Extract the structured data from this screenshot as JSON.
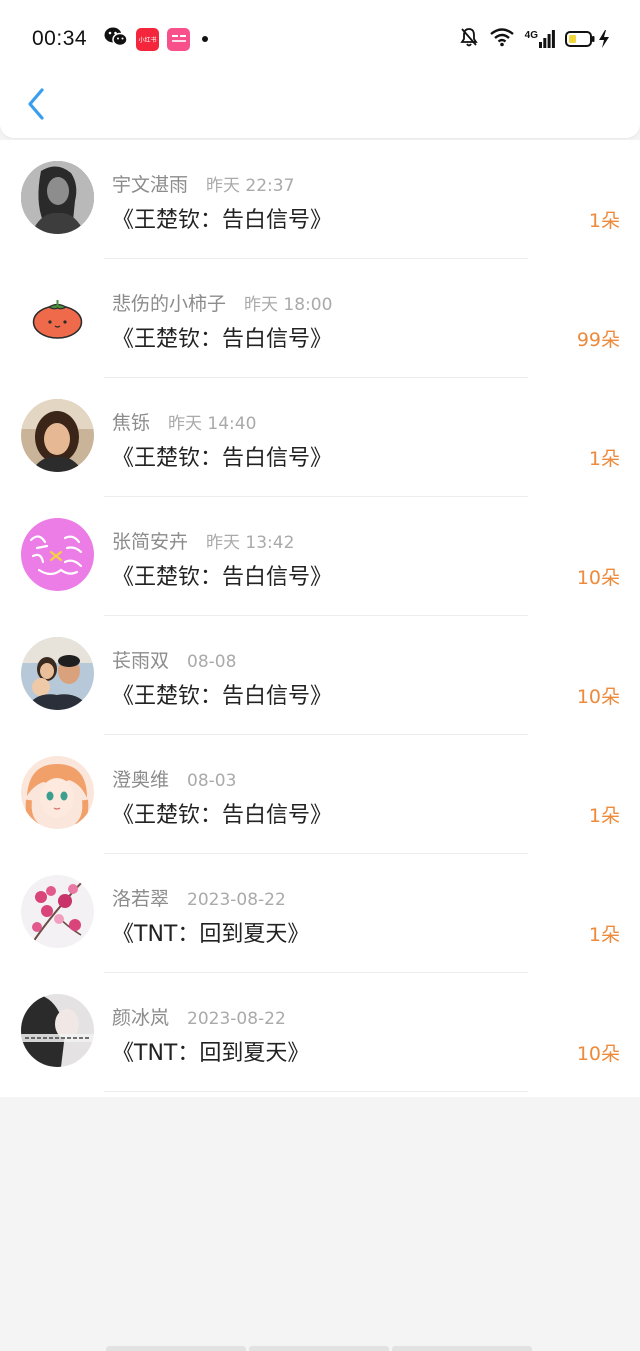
{
  "status_bar": {
    "time": "00:34",
    "apps": [
      {
        "icon": "wechat-icon"
      },
      {
        "icon": "xiaohongshu-icon",
        "label": "小红书",
        "color": "#f3263c"
      },
      {
        "icon": "app-icon",
        "label": "",
        "color": "#f7508b"
      }
    ],
    "right_icons": [
      "notification-muted-icon",
      "wifi-icon",
      "4g-signal-icon",
      "battery-charging-icon"
    ],
    "network": "4G"
  },
  "header": {
    "back_icon": "back-chevron-icon",
    "back_color": "#3a9ef0"
  },
  "rows": [
    {
      "name": "宇文湛雨",
      "time": "昨天 22:37",
      "song": "《王楚钦：告白信号》",
      "count": "1朵"
    },
    {
      "name": "悲伤的小柿子",
      "time": "昨天 18:00",
      "song": "《王楚钦：告白信号》",
      "count": "99朵"
    },
    {
      "name": "焦铄",
      "time": "昨天 14:40",
      "song": "《王楚钦：告白信号》",
      "count": "1朵"
    },
    {
      "name": "张简安卉",
      "time": "昨天 13:42",
      "song": "《王楚钦：告白信号》",
      "count": "10朵"
    },
    {
      "name": "苌雨双",
      "time": "08-08",
      "song": "《王楚钦：告白信号》",
      "count": "10朵"
    },
    {
      "name": "澄奥维",
      "time": "08-03",
      "song": "《王楚钦：告白信号》",
      "count": "1朵"
    },
    {
      "name": "洛若翠",
      "time": "2023-08-22",
      "song": "《TNT：回到夏天》",
      "count": "1朵"
    },
    {
      "name": "颜冰岚",
      "time": "2023-08-22",
      "song": "《TNT：回到夏天》",
      "count": "10朵"
    }
  ],
  "colors": {
    "accent": "#3a9ef0",
    "count": "#ee8a3b",
    "name": "#8c8c8c",
    "time": "#aaaaaa"
  }
}
